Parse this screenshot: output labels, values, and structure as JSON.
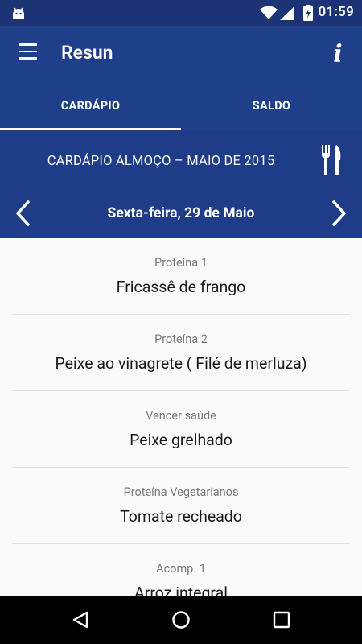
{
  "status_bar": {
    "time": "01:59"
  },
  "app_bar": {
    "title": "Resun",
    "menu_icon": "hamburger-menu-icon",
    "info_icon": "info-icon",
    "info_glyph": "i"
  },
  "tabs": [
    {
      "label": "CARDÁPIO",
      "active": true
    },
    {
      "label": "SALDO",
      "active": false
    }
  ],
  "menu_header": {
    "title": "CARDÁPIO ALMOÇO – MAIO DE 2015",
    "date": "Sexta-feira, 29 de Maio",
    "icon": "cutlery-icon"
  },
  "menu_items": [
    {
      "category": "Proteína 1",
      "dish": "Fricassê de frango"
    },
    {
      "category": "Proteína 2",
      "dish": "Peixe ao vinagrete ( Filé de merluza)"
    },
    {
      "category": "Vencer saúde",
      "dish": "Peixe grelhado"
    },
    {
      "category": "Proteína Vegetarianos",
      "dish": "Tomate recheado"
    },
    {
      "category": "Acomp. 1",
      "dish": "Arroz integral"
    }
  ],
  "colors": {
    "status_bar": "#1c3475",
    "app_bar": "#1f3f8a",
    "header": "#1e3c87",
    "background": "#fafafa"
  }
}
